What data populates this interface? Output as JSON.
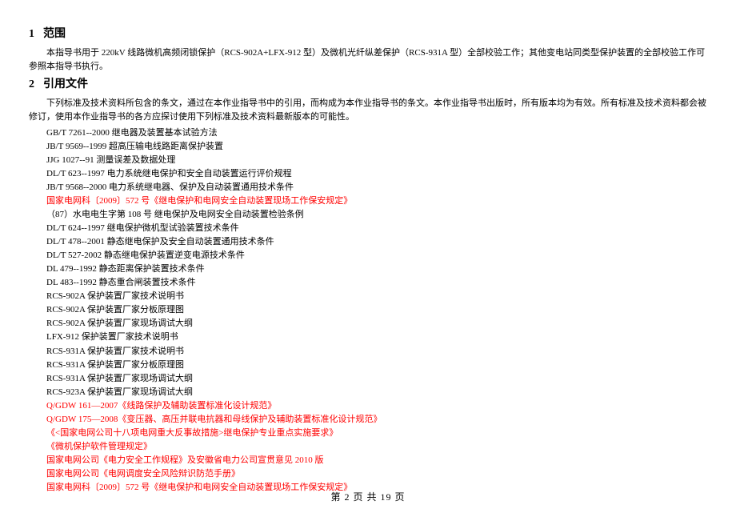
{
  "section1": {
    "num": "1",
    "title": "范围",
    "para": "本指导书用于 220kV 线路微机高频闭锁保护（RCS-902A+LFX-912 型）及微机光纤纵差保护（RCS-931A 型）全部校验工作；其他变电站同类型保护装置的全部校验工作可参照本指导书执行。"
  },
  "section2": {
    "num": "2",
    "title": "引用文件",
    "para": "下列标准及技术资料所包含的条文，通过在本作业指导书中的引用，而构成为本作业指导书的条文。本作业指导书出版时，所有版本均为有效。所有标准及技术资料都会被修订，使用本作业指导书的各方应探讨使用下列标准及技术资料最新版本的可能性。",
    "refs": [
      {
        "text": "GB/T 7261--2000 继电器及装置基本试验方法",
        "red": false
      },
      {
        "text": "JB/T 9569--1999 超高压输电线路距离保护装置",
        "red": false
      },
      {
        "text": "JJG 1027--91 测量误差及数据处理",
        "red": false
      },
      {
        "text": "DL/T 623--1997 电力系统继电保护和安全自动装置运行评价规程",
        "red": false
      },
      {
        "text": "JB/T 9568--2000 电力系统继电器、保护及自动装置通用技术条件",
        "red": false
      },
      {
        "text": "国家电网科〔2009〕572 号《继电保护和电网安全自动装置现场工作保安规定》",
        "red": true
      },
      {
        "text": "（87）水电电生字第 108 号 继电保护及电网安全自动装置检验条例",
        "red": false
      },
      {
        "text": "DL/T 624--1997 继电保护微机型试验装置技术条件",
        "red": false
      },
      {
        "text": "DL/T 478--2001 静态继电保护及安全自动装置通用技术条件",
        "red": false
      },
      {
        "text": "DL/T 527-2002 静态继电保护装置逆变电源技术条件",
        "red": false
      },
      {
        "text": "DL 479--1992 静态距离保护装置技术条件",
        "red": false
      },
      {
        "text": "DL 483--1992 静态重合闸装置技术条件",
        "red": false
      },
      {
        "text": "RCS-902A 保护装置厂家技术说明书",
        "red": false
      },
      {
        "text": "RCS-902A 保护装置厂家分板原理图",
        "red": false
      },
      {
        "text": "RCS-902A 保护装置厂家现场调试大纲",
        "red": false
      },
      {
        "text": "LFX-912 保护装置厂家技术说明书",
        "red": false
      },
      {
        "text": "RCS-931A 保护装置厂家技术说明书",
        "red": false
      },
      {
        "text": "RCS-931A 保护装置厂家分板原理图",
        "red": false
      },
      {
        "text": "RCS-931A 保护装置厂家现场调试大纲",
        "red": false
      },
      {
        "text": "RCS-923A 保护装置厂家现场调试大纲",
        "red": false
      },
      {
        "text": "Q/GDW 161—2007《线路保护及辅助装置标准化设计规范》",
        "red": true
      },
      {
        "text": "Q/GDW 175—2008《变压器、高压并联电抗器和母线保护及辅助装置标准化设计规范》",
        "red": true
      },
      {
        "text": "《<国家电网公司十八项电网重大反事故措施>继电保护专业重点实施要求》",
        "red": true
      },
      {
        "text": "《微机保护软件管理规定》",
        "red": true
      },
      {
        "text": "国家电网公司《电力安全工作规程》及安徽省电力公司宣贯意见 2010 版",
        "red": true
      },
      {
        "text": "国家电网公司《电网调度安全风险辩识防范手册》",
        "red": true
      },
      {
        "text": "国家电网科〔2009〕572 号《继电保护和电网安全自动装置现场工作保安规定》",
        "red": true
      }
    ]
  },
  "footer": "第 2 页 共 19 页"
}
